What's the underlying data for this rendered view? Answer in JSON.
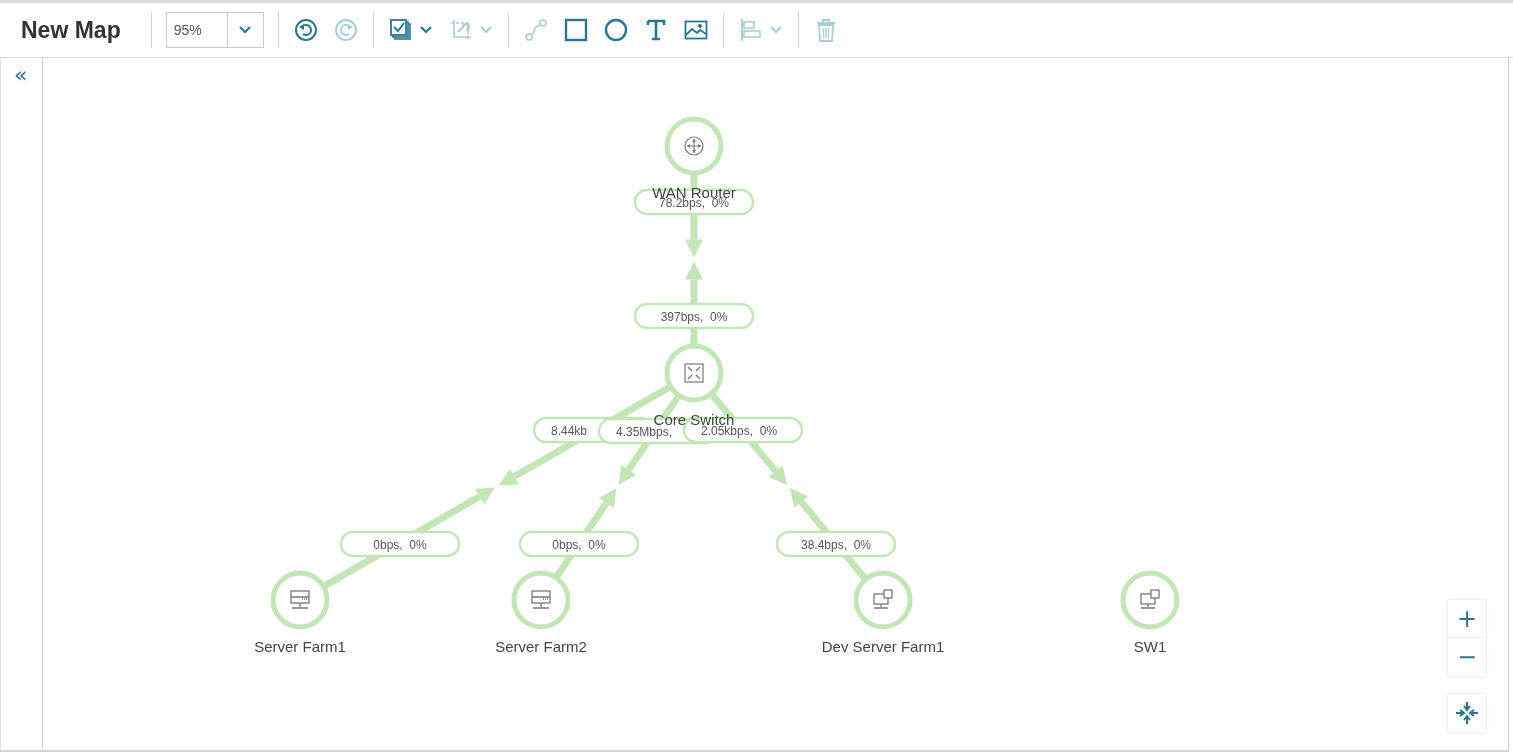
{
  "header": {
    "title": "New Map",
    "zoom": {
      "value": "95%"
    }
  },
  "toolbar": {
    "groups": [
      {
        "items": [
          {
            "kind": "undo",
            "disabled": false,
            "menu": false
          },
          {
            "kind": "redo",
            "disabled": true,
            "menu": false
          }
        ]
      },
      {
        "items": [
          {
            "kind": "select",
            "disabled": false,
            "menu": true
          },
          {
            "kind": "edit-link",
            "disabled": true,
            "menu": true
          }
        ]
      },
      {
        "items": [
          {
            "kind": "connector",
            "disabled": true,
            "menu": false
          },
          {
            "kind": "rectangle",
            "disabled": false,
            "menu": false
          },
          {
            "kind": "circle",
            "disabled": false,
            "menu": false
          },
          {
            "kind": "text",
            "disabled": false,
            "menu": false
          },
          {
            "kind": "image",
            "disabled": false,
            "menu": false
          }
        ]
      },
      {
        "items": [
          {
            "kind": "align",
            "disabled": true,
            "menu": true
          }
        ]
      },
      {
        "items": [
          {
            "kind": "delete",
            "disabled": true,
            "menu": false
          }
        ]
      }
    ]
  },
  "sidebar": {
    "toggle": "«"
  },
  "map": {
    "nodes": [
      {
        "label": "WAN Router",
        "kind": "router",
        "children": [
          {
            "label": "Core Switch",
            "kind": "switch",
            "link": {
              "upper_label": "78.2bps,  0%",
              "lower_label": "397bps,  0%"
            },
            "children": [
              {
                "label": "Server Farm1",
                "kind": "server",
                "link": {
                  "upper_label": "8.44kb",
                  "lower_label": "0bps,  0%"
                }
              },
              {
                "label": "Server Farm2",
                "kind": "server",
                "link": {
                  "upper_label": "4.35Mbps,",
                  "lower_label": "0bps,  0%"
                }
              },
              {
                "label": "Dev Server Farm1",
                "kind": "workstation",
                "link": {
                  "upper_label": "2.05kbps,  0%",
                  "lower_label": "38.4bps,  0%"
                }
              }
            ]
          }
        ]
      },
      {
        "label": "SW1",
        "kind": "workstation"
      }
    ]
  },
  "zoom_controls": {
    "zoom_in": "+",
    "zoom_out": "−"
  }
}
